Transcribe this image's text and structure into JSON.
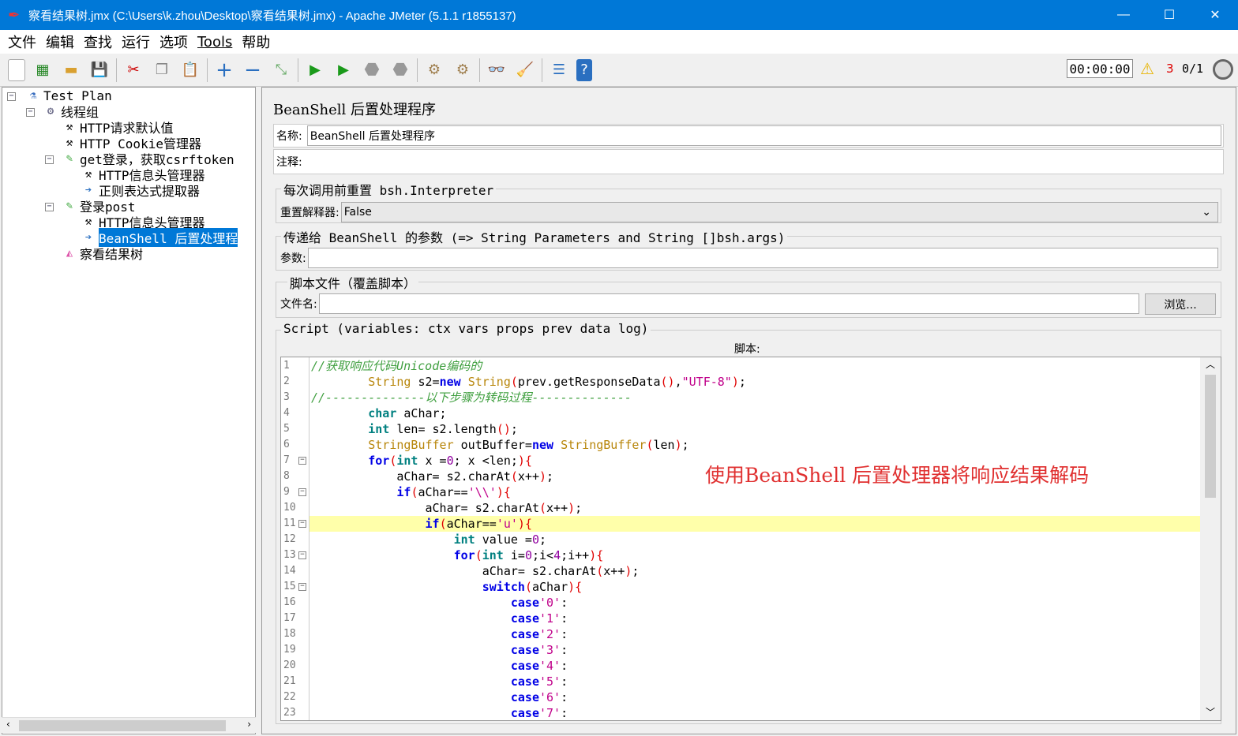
{
  "window": {
    "title": "察看结果树.jmx (C:\\Users\\k.zhou\\Desktop\\察看结果树.jmx) - Apache JMeter (5.1.1 r1855137)",
    "minimize": "—",
    "maximize": "☐",
    "close": "✕"
  },
  "menu": [
    "文件",
    "编辑",
    "查找",
    "运行",
    "选项",
    "Tools",
    "帮助"
  ],
  "toolbar": {
    "timer": "00:00:00",
    "warnings": "3",
    "threads": "0/1"
  },
  "tree": {
    "items": [
      {
        "label": "Test Plan",
        "icon": "test-plan-icon"
      },
      {
        "label": "线程组",
        "icon": "thread-group-icon"
      },
      {
        "label": "HTTP请求默认值",
        "icon": "config-icon"
      },
      {
        "label": "HTTP Cookie管理器",
        "icon": "config-icon"
      },
      {
        "label": "get登录，获取csrftoken",
        "icon": "sampler-icon"
      },
      {
        "label": "HTTP信息头管理器",
        "icon": "config-icon"
      },
      {
        "label": "正则表达式提取器",
        "icon": "postprocessor-icon"
      },
      {
        "label": "登录post",
        "icon": "sampler-icon"
      },
      {
        "label": "HTTP信息头管理器",
        "icon": "config-icon"
      },
      {
        "label": "BeanShell 后置处理程",
        "icon": "postprocessor-icon"
      },
      {
        "label": "察看结果树",
        "icon": "listener-icon"
      }
    ]
  },
  "panel": {
    "title": "BeanShell 后置处理程序",
    "name_label": "名称:",
    "name_value": "BeanShell 后置处理程序",
    "comment_label": "注释:",
    "reset_group": "每次调用前重置 bsh.Interpreter",
    "reset_label": "重置解释器:",
    "reset_value": "False",
    "params_group": "传递给 BeanShell 的参数 (=> String Parameters and String []bsh.args)",
    "params_label": "参数:",
    "file_group": "脚本文件（覆盖脚本）",
    "file_label": "文件名:",
    "browse": "浏览...",
    "script_group": "Script (variables: ctx vars props prev data log)",
    "script_label": "脚本:"
  },
  "code": {
    "highlight_line": 11,
    "fold_lines": [
      7,
      9,
      11,
      13,
      15
    ],
    "lines": [
      [
        [
          "c",
          "//获取响应代码Unicode编码的"
        ]
      ],
      [
        [
          "",
          "        "
        ],
        [
          "y",
          "String"
        ],
        [
          "",
          " s2="
        ],
        [
          "k",
          "new"
        ],
        [
          "",
          " "
        ],
        [
          "y",
          "String"
        ],
        [
          "p",
          "("
        ],
        [
          "",
          "prev.getResponseData"
        ],
        [
          "p",
          "()"
        ],
        [
          "",
          ","
        ],
        [
          "s",
          "\"UTF-8\""
        ],
        [
          "p",
          ")"
        ],
        [
          "",
          ";"
        ]
      ],
      [
        [
          "c",
          "//--------------以下步骤为转码过程--------------"
        ]
      ],
      [
        [
          "",
          "        "
        ],
        [
          "t",
          "char"
        ],
        [
          "",
          " aChar;"
        ]
      ],
      [
        [
          "",
          "        "
        ],
        [
          "t",
          "int"
        ],
        [
          "",
          " len= s2.length"
        ],
        [
          "p",
          "()"
        ],
        [
          "",
          ";"
        ]
      ],
      [
        [
          "",
          "        "
        ],
        [
          "y",
          "StringBuffer"
        ],
        [
          "",
          " outBuffer="
        ],
        [
          "k",
          "new"
        ],
        [
          "",
          " "
        ],
        [
          "y",
          "StringBuffer"
        ],
        [
          "p",
          "("
        ],
        [
          "",
          "len"
        ],
        [
          "p",
          ")"
        ],
        [
          "",
          ";"
        ]
      ],
      [
        [
          "",
          "        "
        ],
        [
          "k",
          "for"
        ],
        [
          "p",
          "("
        ],
        [
          "t",
          "int"
        ],
        [
          "",
          " x ="
        ],
        [
          "n",
          "0"
        ],
        [
          "",
          "; x <len;"
        ],
        [
          "p",
          "){"
        ]
      ],
      [
        [
          "",
          "            aChar= s2.charAt"
        ],
        [
          "p",
          "("
        ],
        [
          "",
          "x++"
        ],
        [
          "p",
          ")"
        ],
        [
          "",
          ";"
        ]
      ],
      [
        [
          "",
          "            "
        ],
        [
          "k",
          "if"
        ],
        [
          "p",
          "("
        ],
        [
          "",
          "aChar=="
        ],
        [
          "s",
          "'\\\\'"
        ],
        [
          "p",
          "){"
        ]
      ],
      [
        [
          "",
          "                aChar= s2.charAt"
        ],
        [
          "p",
          "("
        ],
        [
          "",
          "x++"
        ],
        [
          "p",
          ")"
        ],
        [
          "",
          ";"
        ]
      ],
      [
        [
          "",
          "                "
        ],
        [
          "k",
          "if"
        ],
        [
          "p",
          "("
        ],
        [
          "",
          "aChar=="
        ],
        [
          "s",
          "'u'"
        ],
        [
          "p",
          "){"
        ]
      ],
      [
        [
          "",
          "                    "
        ],
        [
          "t",
          "int"
        ],
        [
          "",
          " value ="
        ],
        [
          "n",
          "0"
        ],
        [
          "",
          ";"
        ]
      ],
      [
        [
          "",
          "                    "
        ],
        [
          "k",
          "for"
        ],
        [
          "p",
          "("
        ],
        [
          "t",
          "int"
        ],
        [
          "",
          " i="
        ],
        [
          "n",
          "0"
        ],
        [
          "",
          ";i<"
        ],
        [
          "n",
          "4"
        ],
        [
          "",
          ";i++"
        ],
        [
          "p",
          "){"
        ]
      ],
      [
        [
          "",
          "                        aChar= s2.charAt"
        ],
        [
          "p",
          "("
        ],
        [
          "",
          "x++"
        ],
        [
          "p",
          ")"
        ],
        [
          "",
          ";"
        ]
      ],
      [
        [
          "",
          "                        "
        ],
        [
          "k",
          "switch"
        ],
        [
          "p",
          "("
        ],
        [
          "",
          "aChar"
        ],
        [
          "p",
          "){"
        ]
      ],
      [
        [
          "",
          "                            "
        ],
        [
          "k",
          "case"
        ],
        [
          "s",
          "'0'"
        ],
        [
          "",
          ":"
        ]
      ],
      [
        [
          "",
          "                            "
        ],
        [
          "k",
          "case"
        ],
        [
          "s",
          "'1'"
        ],
        [
          "",
          ":"
        ]
      ],
      [
        [
          "",
          "                            "
        ],
        [
          "k",
          "case"
        ],
        [
          "s",
          "'2'"
        ],
        [
          "",
          ":"
        ]
      ],
      [
        [
          "",
          "                            "
        ],
        [
          "k",
          "case"
        ],
        [
          "s",
          "'3'"
        ],
        [
          "",
          ":"
        ]
      ],
      [
        [
          "",
          "                            "
        ],
        [
          "k",
          "case"
        ],
        [
          "s",
          "'4'"
        ],
        [
          "",
          ":"
        ]
      ],
      [
        [
          "",
          "                            "
        ],
        [
          "k",
          "case"
        ],
        [
          "s",
          "'5'"
        ],
        [
          "",
          ":"
        ]
      ],
      [
        [
          "",
          "                            "
        ],
        [
          "k",
          "case"
        ],
        [
          "s",
          "'6'"
        ],
        [
          "",
          ":"
        ]
      ],
      [
        [
          "",
          "                            "
        ],
        [
          "k",
          "case"
        ],
        [
          "s",
          "'7'"
        ],
        [
          "",
          ":"
        ]
      ]
    ]
  },
  "annotation": "使用BeanShell 后置处理器将响应结果解码"
}
